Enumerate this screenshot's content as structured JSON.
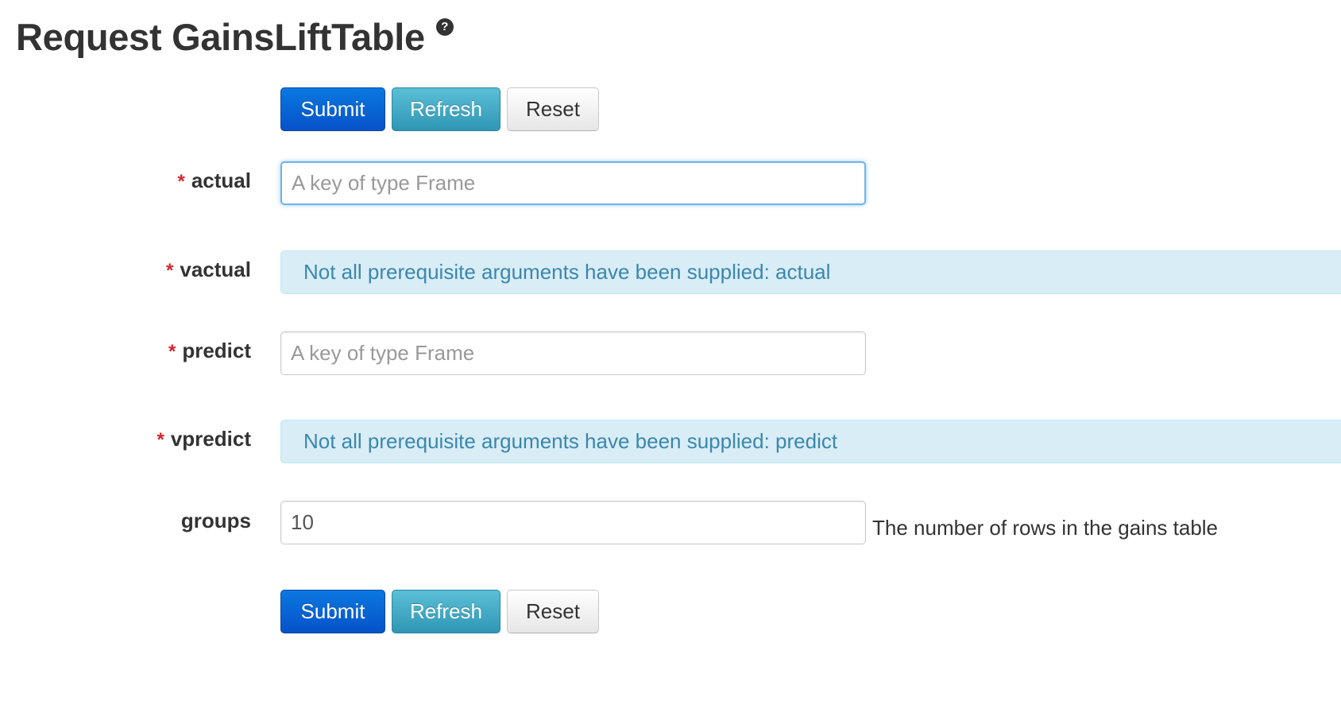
{
  "header": {
    "title": "Request GainsLiftTable",
    "help_icon": "question-circle-icon"
  },
  "buttons": {
    "submit": "Submit",
    "refresh": "Refresh",
    "reset": "Reset"
  },
  "colors": {
    "primary": "#0652c8",
    "info": "#2f96b4",
    "required_star": "#d4262b",
    "alert_bg": "#d9edf7",
    "alert_text": "#3a87ad"
  },
  "fields": {
    "actual": {
      "required_mark": "*",
      "label": "actual",
      "placeholder": "A key of type Frame",
      "value": ""
    },
    "vactual": {
      "required_mark": "*",
      "label": "vactual",
      "message": "Not all prerequisite arguments have been supplied: actual"
    },
    "predict": {
      "required_mark": "*",
      "label": "predict",
      "placeholder": "A key of type Frame",
      "value": ""
    },
    "vpredict": {
      "required_mark": "*",
      "label": "vpredict",
      "message": "Not all prerequisite arguments have been supplied: predict"
    },
    "groups": {
      "label": "groups",
      "value": "10",
      "help": "The number of rows in the gains table"
    }
  }
}
